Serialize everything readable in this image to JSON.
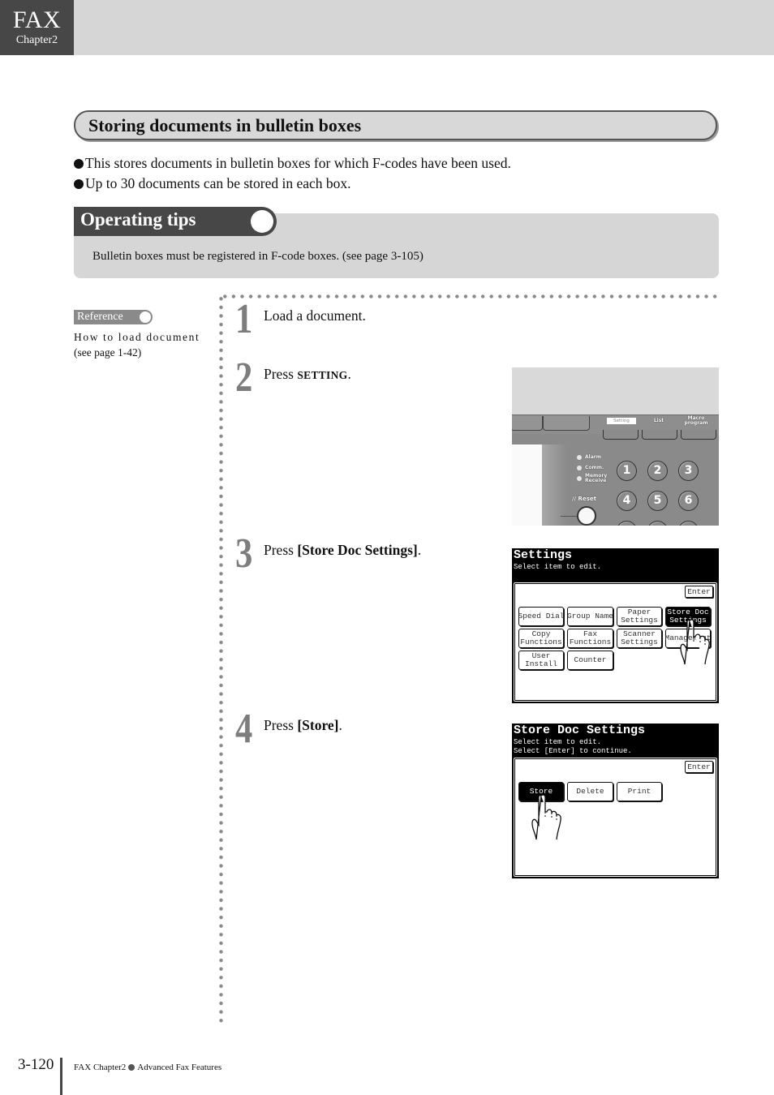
{
  "header": {
    "chapter_title": "FAX",
    "chapter_label": "Chapter2"
  },
  "section": {
    "title": "Storing documents in bulletin boxes",
    "bullets": [
      "This stores documents in bulletin boxes for which F-codes have been used.",
      "Up to 30 documents can be stored in each box."
    ]
  },
  "operating_tips": {
    "title": "Operating tips",
    "text": "Bulletin boxes must be registered in F-code boxes. (see page 3-105)"
  },
  "reference": {
    "badge": "Reference",
    "line1": "How to load document",
    "line2": "(see page 1-42)"
  },
  "steps": [
    {
      "number": "1",
      "prefix": "Load a document.",
      "key": "",
      "suffix": ""
    },
    {
      "number": "2",
      "prefix": "Press ",
      "key": "SETTING",
      "suffix": "."
    },
    {
      "number": "3",
      "prefix": "Press ",
      "key": "[Store Doc Settings]",
      "suffix": "."
    },
    {
      "number": "4",
      "prefix": "Press ",
      "key": "[Store]",
      "suffix": "."
    }
  ],
  "control_panel_photo": {
    "keys": [
      "Setting",
      "List",
      "Macro program"
    ],
    "indicators": [
      "Alarm",
      "Comm.",
      "Memory Receive"
    ],
    "reset_label": "// Reset",
    "number_keys": [
      "1",
      "2",
      "3",
      "4",
      "5",
      "6"
    ]
  },
  "settings_screen": {
    "title": "Settings",
    "subtitle": "Select item to edit.",
    "enter_label": "Enter",
    "buttons": [
      {
        "label": "Speed Dial",
        "selected": false
      },
      {
        "label": "Group Name",
        "selected": false
      },
      {
        "label": "Paper\nSettings",
        "selected": false
      },
      {
        "label": "Store Doc\nSettings",
        "selected": true
      },
      {
        "label": "Copy\nFunctions",
        "selected": false
      },
      {
        "label": "Fax\nFunctions",
        "selected": false
      },
      {
        "label": "Scanner\nSettings",
        "selected": false
      },
      {
        "label": "Management",
        "selected": false
      },
      {
        "label": "User\nInstall",
        "selected": false
      },
      {
        "label": "Counter",
        "selected": false
      }
    ]
  },
  "store_doc_screen": {
    "title": "Store Doc Settings",
    "subtitle1": "Select item to edit.",
    "subtitle2": "Select [Enter] to continue.",
    "enter_label": "Enter",
    "buttons": [
      {
        "label": "Store",
        "selected": true
      },
      {
        "label": "Delete",
        "selected": false
      },
      {
        "label": "Print",
        "selected": false
      }
    ]
  },
  "footer": {
    "page_number": "3-120",
    "chapter": "FAX Chapter2",
    "section": "Advanced Fax Features"
  }
}
